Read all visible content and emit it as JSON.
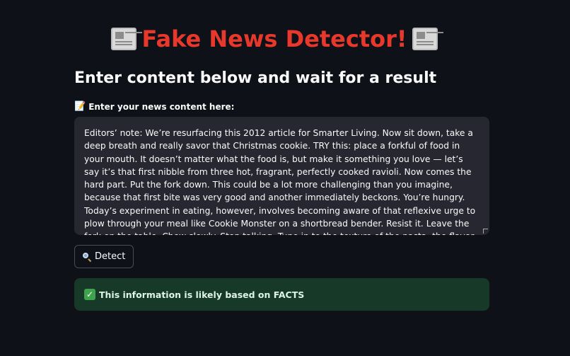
{
  "header": {
    "title": "Fake News Detector!",
    "left_icon": "newspaper-icon",
    "right_icon": "newspaper-icon"
  },
  "main": {
    "subheader": "Enter content below and wait for a result",
    "input": {
      "label": "Enter your news content here:",
      "label_icon": "memo-icon",
      "value": "Editors’ note: We’re resurfacing this 2012 article for Smarter Living. Now sit down, take a deep breath and really savor that Christmas cookie. TRY this: place a forkful of food in your mouth. It doesn’t matter what the food is, but make it something you love — let’s say it’s that first nibble from three hot, fragrant, perfectly cooked ravioli. Now comes the hard part. Put the fork down. This could be a lot more challenging than you imagine, because that first bite was very good and another immediately beckons. You’re hungry. Today’s experiment in eating, however, involves becoming aware of that reflexive urge to plow through your meal like Cookie Monster on a shortbread bender. Resist it. Leave the fork on the table. Chew slowly. Stop talking. Tune in to the texture of the pasta, the flavor of the cheese, the bright acidity of the tomatoes, the depth and aroma of the spices."
    },
    "detect_button": {
      "label": "Detect",
      "icon": "magnifying-glass-icon"
    },
    "result": {
      "icon": "check-mark-icon",
      "text": "This information is likely based on FACTS"
    }
  },
  "colors": {
    "background": "#0e1117",
    "title": "#e8382c",
    "textarea_bg": "#262730",
    "success_bg": "#173928",
    "success_check": "#3fa34d"
  }
}
